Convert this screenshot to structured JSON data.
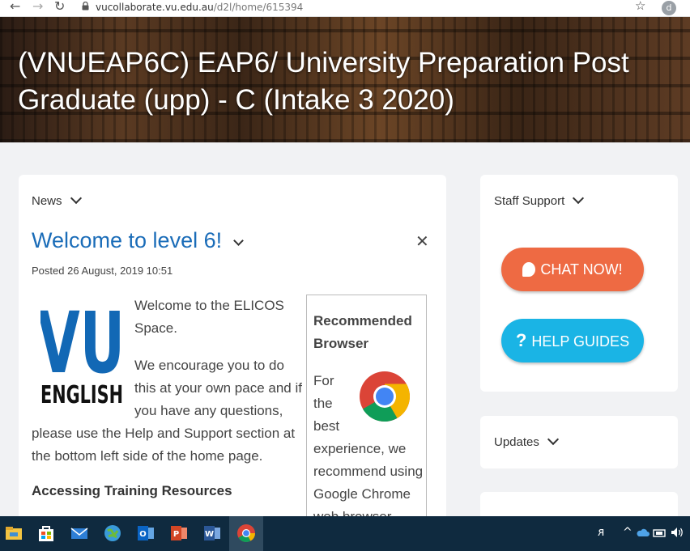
{
  "browser": {
    "url_domain": "vucollaborate.vu.edu.au",
    "url_path": "/d2l/home/615394",
    "profile_initial": "d"
  },
  "banner": {
    "course_title": "(VNUEAP6C) EAP6/ University Preparation Post Graduate (upp) - C (Intake 3 2020)"
  },
  "news": {
    "header": "News",
    "item_title": "Welcome to level 6!",
    "posted": "Posted 26 August, 2019 10:51",
    "para1": "Welcome to the ELICOS Space.",
    "para2a": "We encourage you to do this at your own pace and if you have any questions,",
    "para2b": "please use the Help and Support section at the bottom left side of the home page.",
    "section_heading": "Accessing Training Resources",
    "logo": {
      "line1": "VU",
      "line2": "ENGLISH"
    },
    "recommended": {
      "title": "Recommended Browser",
      "text1": "For the best",
      "text2": "experience, we recommend using Google Chrome web browser"
    }
  },
  "staff_support": {
    "header": "Staff Support",
    "chat_label": "CHAT NOW!",
    "help_label": "HELP GUIDES",
    "help_icon": "?"
  },
  "updates": {
    "header": "Updates"
  },
  "colors": {
    "link_blue": "#1a6cb8",
    "chat_orange": "#ee6a43",
    "help_blue": "#1ab4e5",
    "taskbar": "#0f2a3f"
  }
}
